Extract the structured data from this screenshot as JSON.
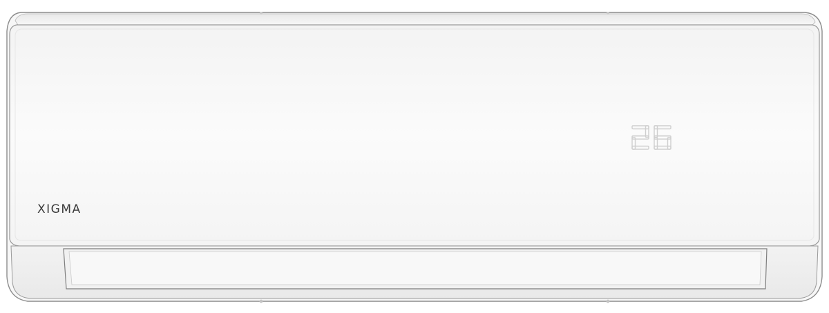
{
  "device": {
    "brand": "XIGMA",
    "display_temperature": "26"
  },
  "colors": {
    "body": "#f6f6f6",
    "outline": "#9a9a9a",
    "brand_text": "#3c3c3c",
    "display_segment": "#cfcfcf"
  }
}
